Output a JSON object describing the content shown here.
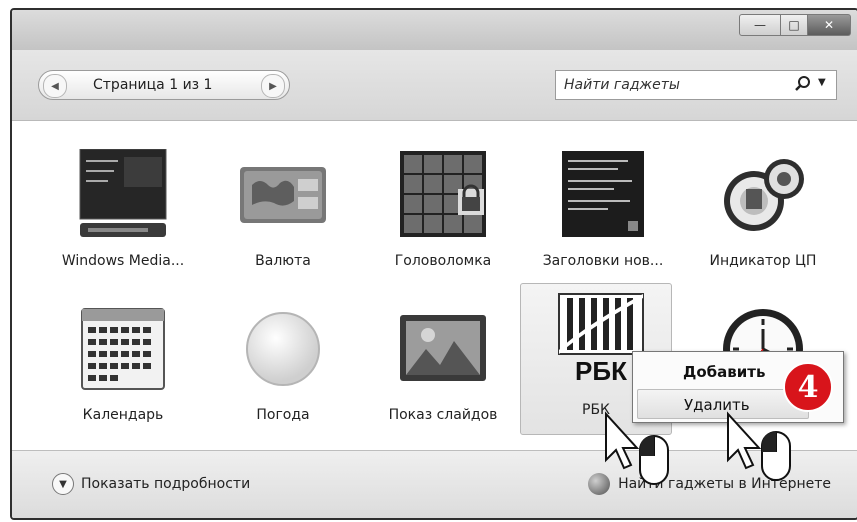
{
  "window": {
    "minimize_icon": "minimize-icon",
    "maximize_icon": "maximize-icon",
    "close_icon": "close-icon"
  },
  "toolbar": {
    "prev_icon": "chevron-left-icon",
    "page_text": "Страница 1 из 1",
    "next_icon": "chevron-right-icon",
    "search_placeholder": "Найти гаджеты",
    "search_icon": "search-icon",
    "dropdown_icon": "chevron-down-icon"
  },
  "gadgets": [
    {
      "label": "Windows Media...",
      "icon": "media-center-icon"
    },
    {
      "label": "Валюта",
      "icon": "currency-icon"
    },
    {
      "label": "Головоломка",
      "icon": "puzzle-icon"
    },
    {
      "label": "Заголовки нов...",
      "icon": "news-icon"
    },
    {
      "label": "Индикатор ЦП",
      "icon": "cpu-meter-icon"
    },
    {
      "label": "Календарь",
      "icon": "calendar-icon"
    },
    {
      "label": "Погода",
      "icon": "weather-icon"
    },
    {
      "label": "Показ слайдов",
      "icon": "slideshow-icon"
    },
    {
      "label": "РБК",
      "icon": "rbk-icon",
      "logo_text": "РБК"
    },
    {
      "label": "",
      "icon": "clock-icon"
    }
  ],
  "context_menu": {
    "add_label": "Добавить",
    "delete_label": "Удалить"
  },
  "step_badge": "4",
  "footer": {
    "details_label": "Показать подробности",
    "details_icon": "chevron-down-icon",
    "online_label": "Найти гаджеты в Интернете",
    "online_icon": "globe-icon"
  }
}
